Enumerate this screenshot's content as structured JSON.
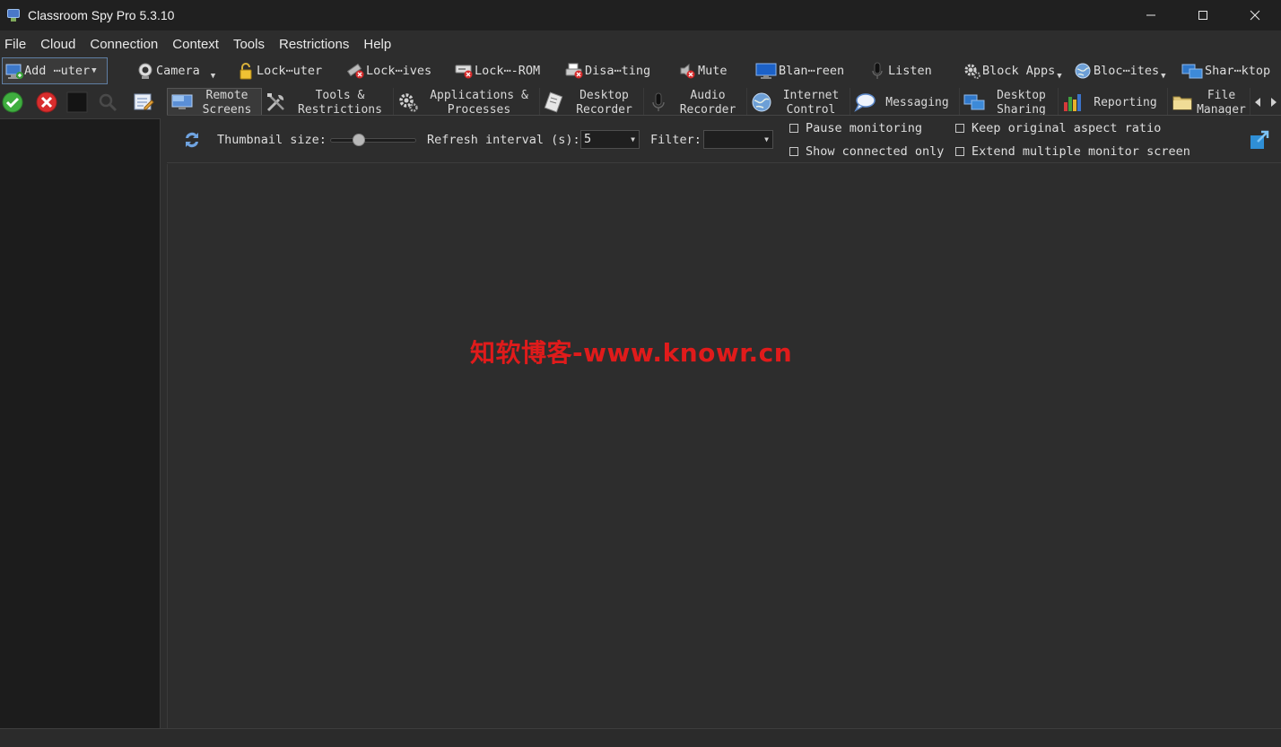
{
  "window": {
    "title": "Classroom Spy Pro 5.3.10"
  },
  "menu": [
    "File",
    "Cloud",
    "Connection",
    "Context",
    "Tools",
    "Restrictions",
    "Help"
  ],
  "toolbar": {
    "add_computer": "Add ⋯uter",
    "camera": "Camera",
    "lock_computer": "Lock⋯uter",
    "lock_drives": "Lock⋯ives",
    "lock_cdrom": "Lock⋯-ROM",
    "disable_printing": "Disa⋯ting",
    "mute": "Mute",
    "blank_screen": "Blan⋯reen",
    "listen": "Listen",
    "block_apps": "Block Apps",
    "block_sites": "Bloc⋯ites",
    "share_desktop": "Shar⋯ktop"
  },
  "tabs": [
    {
      "label": "Remote\nScreens",
      "icon": "monitor-icon"
    },
    {
      "label": "Tools &\nRestrictions",
      "icon": "tools-icon"
    },
    {
      "label": "Applications &\nProcesses",
      "icon": "gears-icon"
    },
    {
      "label": "Desktop\nRecorder",
      "icon": "recorder-icon"
    },
    {
      "label": "Audio\nRecorder",
      "icon": "microphone-icon"
    },
    {
      "label": "Internet\nControl",
      "icon": "globe-icon"
    },
    {
      "label": "Messaging",
      "icon": "chat-icon"
    },
    {
      "label": "Desktop\nSharing",
      "icon": "share-icon"
    },
    {
      "label": "Reporting",
      "icon": "chart-icon"
    },
    {
      "label": "File\nManager",
      "icon": "folder-icon"
    }
  ],
  "options": {
    "thumbnail_size_label": "Thumbnail size:",
    "thumbnail_size_value": 0.3,
    "refresh_label": "Refresh interval (s):",
    "refresh_value": "5",
    "filter_label": "Filter:",
    "filter_value": "",
    "pause_monitoring": "Pause monitoring",
    "show_connected_only": "Show connected only",
    "keep_aspect_ratio": "Keep original aspect ratio",
    "extend_monitors": "Extend multiple monitor screen"
  },
  "watermark": "知软博客-www.knowr.cn",
  "colors": {
    "accent": "#5f7ea3",
    "watermark": "#e01b1b"
  }
}
